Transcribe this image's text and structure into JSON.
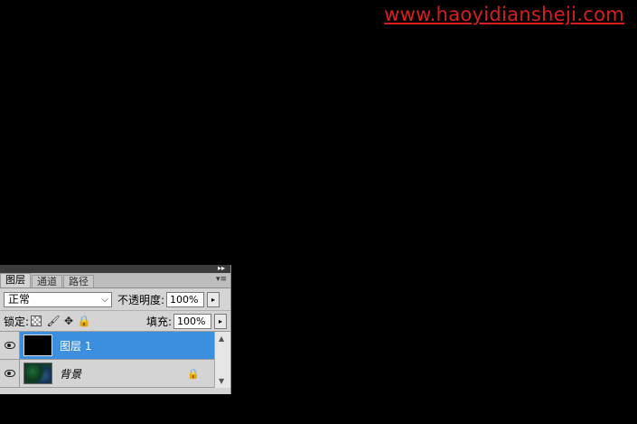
{
  "watermark": "www.haoyidiansheji.com",
  "panel": {
    "collapse_icon": "double-chevron-right-icon",
    "menu_icon": "panel-menu-icon",
    "tabs": [
      {
        "label": "图层",
        "active": true
      },
      {
        "label": "通道",
        "active": false
      },
      {
        "label": "路径",
        "active": false
      }
    ],
    "blend_mode": "正常",
    "opacity_label": "不透明度:",
    "opacity_value": "100%",
    "lock_label": "锁定:",
    "lock_icons": [
      "lock-transparent-icon",
      "brush-icon",
      "move-icon",
      "lock-icon"
    ],
    "fill_label": "填充:",
    "fill_value": "100%",
    "layers": [
      {
        "name": "图层 1",
        "selected": true,
        "thumbnail": "black"
      },
      {
        "name": "背景",
        "selected": false,
        "thumbnail": "green",
        "locked": true
      }
    ]
  },
  "colors": {
    "watermark": "#d81e1e",
    "selection": "#3c8fde",
    "panel_bg": "#d4d4d4"
  }
}
